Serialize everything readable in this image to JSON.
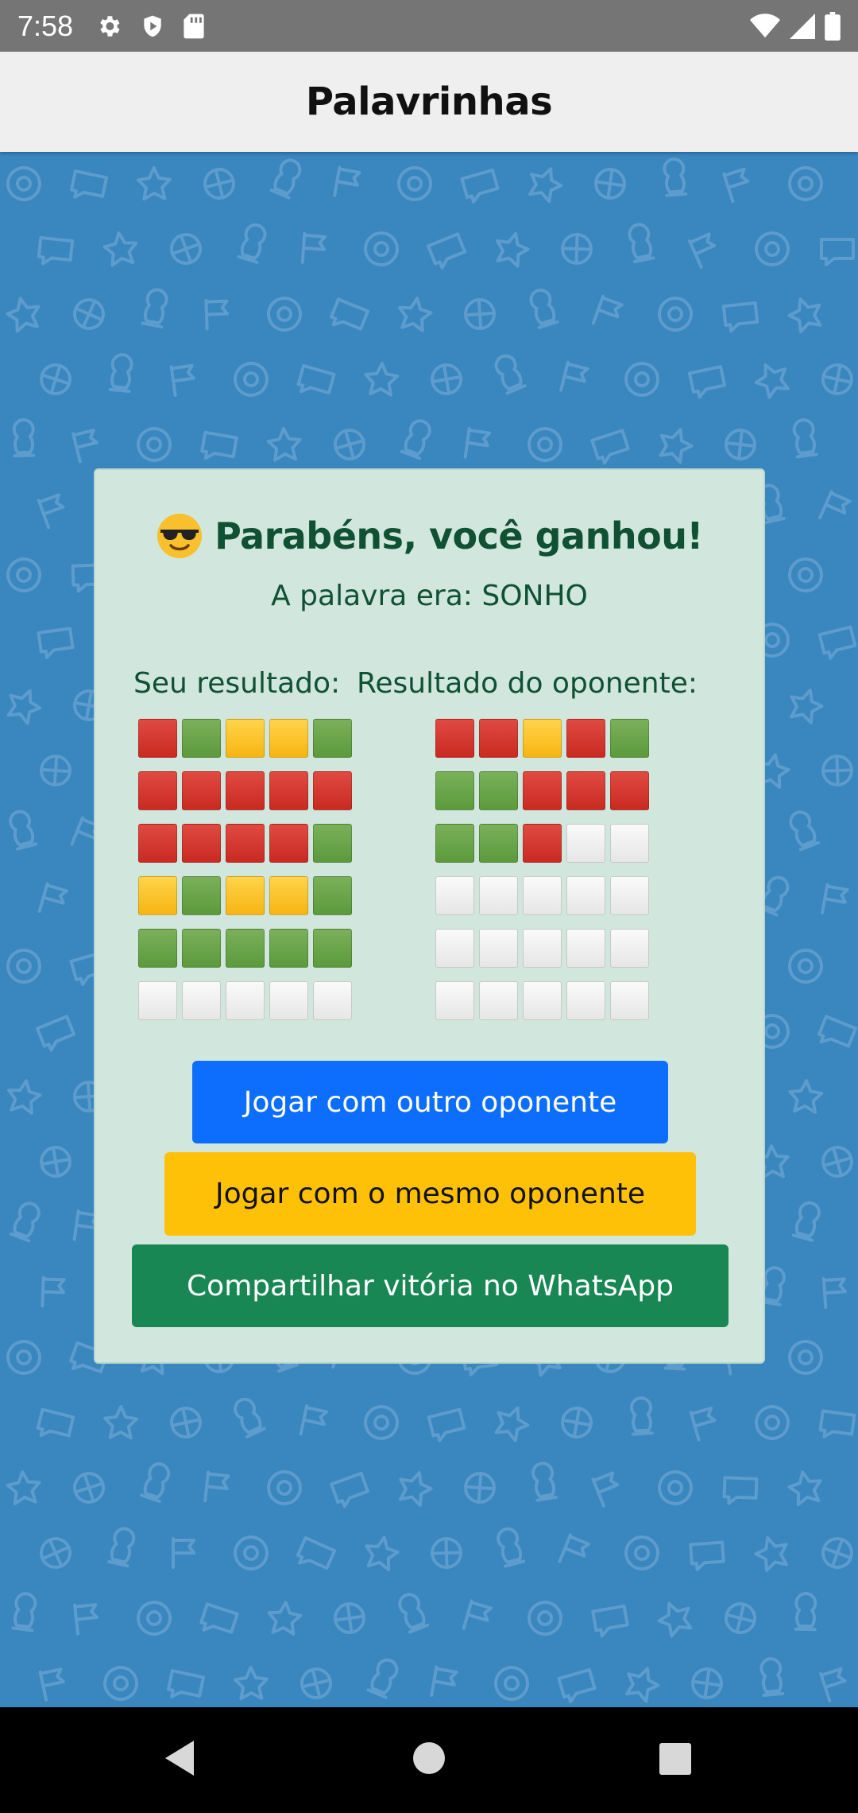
{
  "status_bar": {
    "time": "7:58",
    "left_icons": [
      "settings-icon",
      "shield-play-icon",
      "sd-card-icon"
    ],
    "right_icons": [
      "wifi-icon",
      "cell-signal-icon",
      "battery-icon"
    ]
  },
  "app_bar": {
    "title": "Palavrinhas"
  },
  "result": {
    "emoji": "sunglasses-smile-emoji",
    "title": "Parabéns, você ganhou!",
    "word_line": "A palavra era: SONHO",
    "yours_label": "Seu resultado:",
    "opponent_label": "Resultado do oponente:",
    "legend": {
      "r": "wrong",
      "g": "correct",
      "y": "misplaced",
      "w": "empty"
    },
    "yours_grid": [
      [
        "r",
        "g",
        "y",
        "y",
        "g"
      ],
      [
        "r",
        "r",
        "r",
        "r",
        "r"
      ],
      [
        "r",
        "r",
        "r",
        "r",
        "g"
      ],
      [
        "y",
        "g",
        "y",
        "y",
        "g"
      ],
      [
        "g",
        "g",
        "g",
        "g",
        "g"
      ],
      [
        "w",
        "w",
        "w",
        "w",
        "w"
      ]
    ],
    "opponent_grid": [
      [
        "r",
        "r",
        "y",
        "r",
        "g"
      ],
      [
        "g",
        "g",
        "r",
        "r",
        "r"
      ],
      [
        "g",
        "g",
        "r",
        "w",
        "w"
      ],
      [
        "w",
        "w",
        "w",
        "w",
        "w"
      ],
      [
        "w",
        "w",
        "w",
        "w",
        "w"
      ],
      [
        "w",
        "w",
        "w",
        "w",
        "w"
      ]
    ]
  },
  "buttons": {
    "play_other": "Jogar com outro oponente",
    "play_same": "Jogar com o mesmo oponente",
    "share_whatsapp": "Compartilhar vitória no WhatsApp"
  },
  "colors": {
    "background": "#3a86bf",
    "card": "#d1e7de",
    "card_text": "#0f5132",
    "btn_primary": "#0d6efd",
    "btn_warning": "#ffc107",
    "btn_success": "#198754",
    "tile_red": "#d9372f",
    "tile_green": "#6aa64b",
    "tile_yellow": "#fcc22a",
    "tile_empty": "#f0f0f0"
  },
  "nav_bar": {
    "icons": [
      "back-icon",
      "home-icon",
      "recents-icon"
    ]
  }
}
